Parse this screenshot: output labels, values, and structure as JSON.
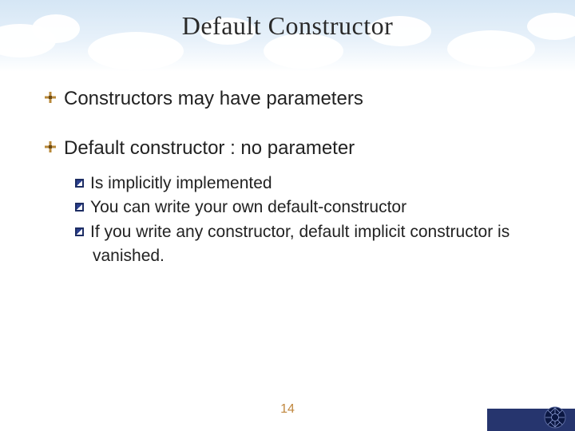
{
  "title": "Default Constructor",
  "bullets": [
    {
      "text": "Constructors may have parameters",
      "sub": []
    },
    {
      "text": "Default constructor : no parameter",
      "sub": [
        "Is implicitly implemented",
        "You can write your own default-constructor",
        "If you write any constructor, default implicit constructor is vanished."
      ]
    }
  ],
  "page_number": "14"
}
